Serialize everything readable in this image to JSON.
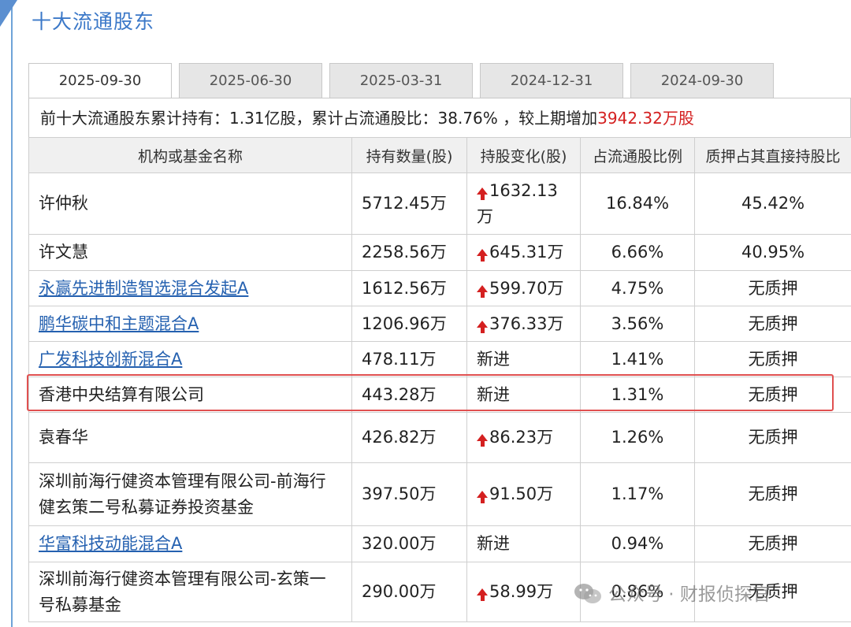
{
  "section_title": "十大流通股东",
  "tabs": [
    {
      "label": "2025-09-30",
      "active": true
    },
    {
      "label": "2025-06-30",
      "active": false
    },
    {
      "label": "2025-03-31",
      "active": false
    },
    {
      "label": "2024-12-31",
      "active": false
    },
    {
      "label": "2024-09-30",
      "active": false
    }
  ],
  "summary": {
    "text": "前十大流通股东累计持有：1.31亿股，累计占流通股比：38.76% ，较上期增加",
    "increase": "3942.32万股"
  },
  "table": {
    "headers": [
      "机构或基金名称",
      "持有数量(股)",
      "持股变化(股)",
      "占流通股比例",
      "质押占其直接持股比"
    ],
    "rows": [
      {
        "name": "许仲秋",
        "link": false,
        "shares": "5712.45万",
        "change": "1632.13万",
        "change_up": true,
        "ratio": "16.84%",
        "pledge": "45.42%"
      },
      {
        "name": "许文慧",
        "link": false,
        "shares": "2258.56万",
        "change": "645.31万",
        "change_up": true,
        "ratio": "6.66%",
        "pledge": "40.95%"
      },
      {
        "name": "永赢先进制造智选混合发起A",
        "link": true,
        "shares": "1612.56万",
        "change": "599.70万",
        "change_up": true,
        "ratio": "4.75%",
        "pledge": "无质押"
      },
      {
        "name": "鹏华碳中和主题混合A",
        "link": true,
        "shares": "1206.96万",
        "change": "376.33万",
        "change_up": true,
        "ratio": "3.56%",
        "pledge": "无质押"
      },
      {
        "name": "广发科技创新混合A",
        "link": true,
        "shares": "478.11万",
        "change": "新进",
        "change_up": false,
        "ratio": "1.41%",
        "pledge": "无质押"
      },
      {
        "name": "香港中央结算有限公司",
        "link": false,
        "shares": "443.28万",
        "change": "新进",
        "change_up": false,
        "ratio": "1.31%",
        "pledge": "无质押"
      },
      {
        "name": "袁春华",
        "link": false,
        "shares": "426.82万",
        "change": "86.23万",
        "change_up": true,
        "ratio": "1.26%",
        "pledge": "无质押"
      },
      {
        "name": "深圳前海行健资本管理有限公司-前海行健玄策二号私募证券投资基金",
        "link": false,
        "shares": "397.50万",
        "change": "91.50万",
        "change_up": true,
        "ratio": "1.17%",
        "pledge": "无质押"
      },
      {
        "name": "华富科技动能混合A",
        "link": true,
        "shares": "320.00万",
        "change": "新进",
        "change_up": false,
        "ratio": "0.94%",
        "pledge": "无质押"
      },
      {
        "name": "深圳前海行健资本管理有限公司-玄策一号私募基金",
        "link": false,
        "shares": "290.00万",
        "change": "58.99万",
        "change_up": true,
        "ratio": "0.86%",
        "pledge": "无质押"
      }
    ]
  },
  "watermark": "公众号 · 财报侦探官",
  "colors": {
    "accent": "#3b78c8",
    "increase": "#d42020",
    "link": "#2561b0",
    "highlight": "#e05050"
  }
}
